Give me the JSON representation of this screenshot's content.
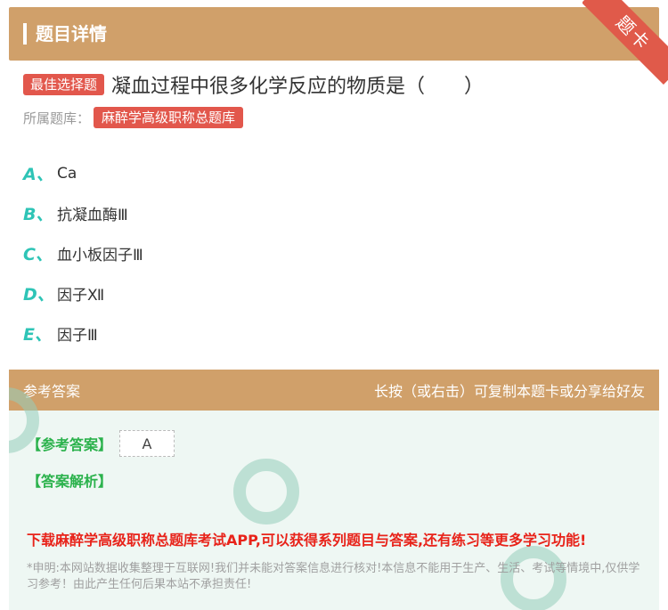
{
  "header": {
    "title": "题目详情",
    "ribbon": "题卡"
  },
  "question": {
    "badge": "最佳选择题",
    "text": "凝血过程中很多化学反应的物质是（　　）",
    "source_label": "所属题库：",
    "source_tag": "麻醉学高级职称总题库"
  },
  "options": [
    {
      "letter": "A、",
      "text": "Ca"
    },
    {
      "letter": "B、",
      "text": "抗凝血酶Ⅲ"
    },
    {
      "letter": "C、",
      "text": "血小板因子Ⅲ"
    },
    {
      "letter": "D、",
      "text": "因子Ⅻ"
    },
    {
      "letter": "E、",
      "text": "因子Ⅲ"
    }
  ],
  "answer_panel": {
    "title": "参考答案",
    "hint": "长按（或右击）可复制本题卡或分享给好友",
    "answer_label": "【参考答案】",
    "answer_value": "A",
    "analysis_label": "【答案解析】",
    "promo": "下载麻醉学高级职称总题库考试APP,可以获得系列题目与答案,还有练习等更多学习功能!",
    "disclaimer": "*申明:本网站数据收集整理于互联网!我们并未能对答案信息进行核对!本信息不能用于生产、生活、考试等情境中,仅供学习参考！由此产生任何后果本站不承担责任!"
  },
  "colors": {
    "header_bg": "#d0a06a",
    "badge_bg": "#e2574c",
    "option_letter": "#2ec4b6",
    "answer_label": "#2bb24c",
    "promo": "#e8231a"
  }
}
